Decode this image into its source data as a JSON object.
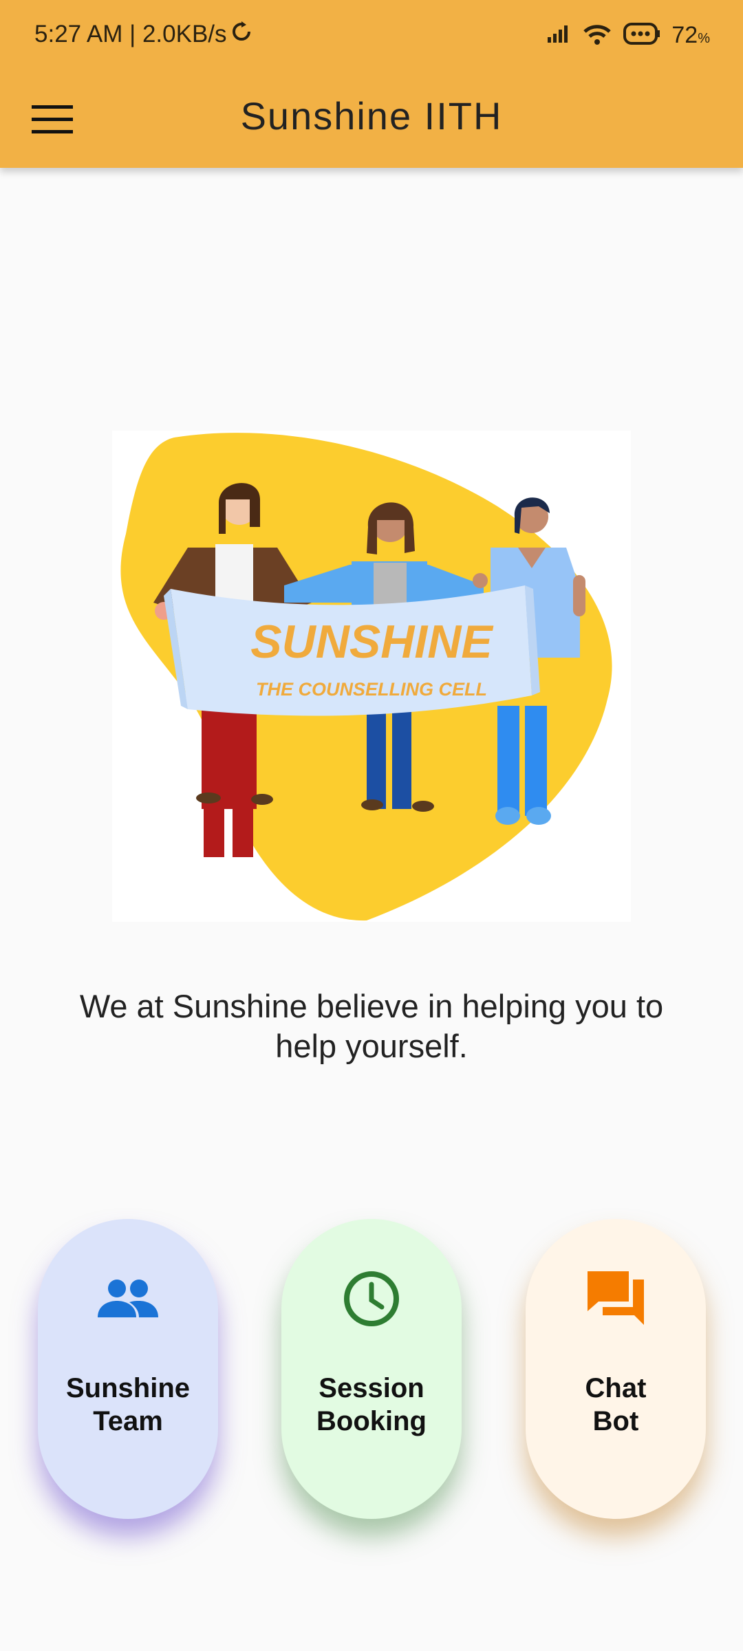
{
  "status_bar": {
    "time_speed": "5:27 AM | 2.0KB/s",
    "battery_level": "72",
    "battery_unit": "%"
  },
  "app_bar": {
    "title": "Sunshine IITH",
    "menu_icon": "hamburger-menu-icon"
  },
  "hero": {
    "banner_title": "SUNSHINE",
    "banner_subtitle": "THE COUNSELLING CELL"
  },
  "tagline": "We at Sunshine believe in helping you to help yourself.",
  "tiles": [
    {
      "line1": "Sunshine",
      "line2": "Team",
      "icon": "people-icon",
      "icon_color": "#1a73d6"
    },
    {
      "line1": "Session",
      "line2": "Booking",
      "icon": "clock-icon",
      "icon_color": "#2e7d32"
    },
    {
      "line1": "Chat",
      "line2": "Bot",
      "icon": "chat-icon",
      "icon_color": "#f57c00"
    }
  ],
  "colors": {
    "app_bar": "#f2b145",
    "hero_blob": "#fccd2e",
    "banner": "#d6e6fb",
    "banner_text": "#f0aa3c"
  }
}
